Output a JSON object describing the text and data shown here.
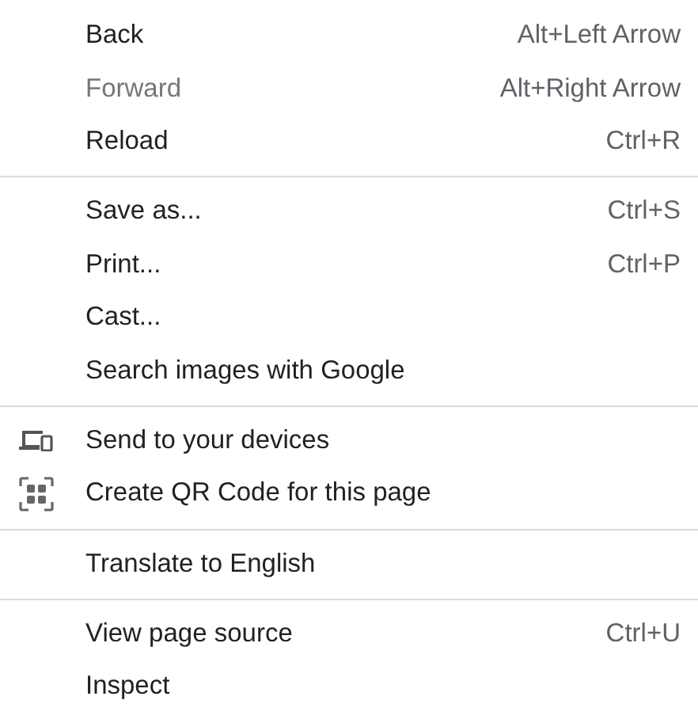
{
  "menu": {
    "sections": [
      {
        "items": [
          {
            "kind": "plain",
            "label": "Back",
            "shortcut": "Alt+Left Arrow",
            "disabled": false
          },
          {
            "kind": "plain",
            "label": "Forward",
            "shortcut": "Alt+Right Arrow",
            "disabled": true
          },
          {
            "kind": "plain",
            "label": "Reload",
            "shortcut": "Ctrl+R",
            "disabled": false
          }
        ]
      },
      {
        "items": [
          {
            "kind": "plain",
            "label": "Save as...",
            "shortcut": "Ctrl+S",
            "disabled": false
          },
          {
            "kind": "plain",
            "label": "Print...",
            "shortcut": "Ctrl+P",
            "disabled": false
          },
          {
            "kind": "plain",
            "label": "Cast...",
            "disabled": false
          },
          {
            "kind": "plain",
            "label": "Search images with Google",
            "disabled": false
          }
        ]
      },
      {
        "items": [
          {
            "kind": "devices",
            "label": "Send to your devices",
            "disabled": false
          },
          {
            "kind": "qr",
            "label": "Create QR Code for this page",
            "disabled": false
          }
        ]
      },
      {
        "items": [
          {
            "kind": "plain",
            "label": "Translate to English",
            "disabled": false
          }
        ]
      },
      {
        "items": [
          {
            "kind": "plain",
            "label": "View page source",
            "shortcut": "Ctrl+U",
            "disabled": false
          },
          {
            "kind": "plain",
            "label": "Inspect",
            "disabled": false
          }
        ]
      }
    ]
  }
}
